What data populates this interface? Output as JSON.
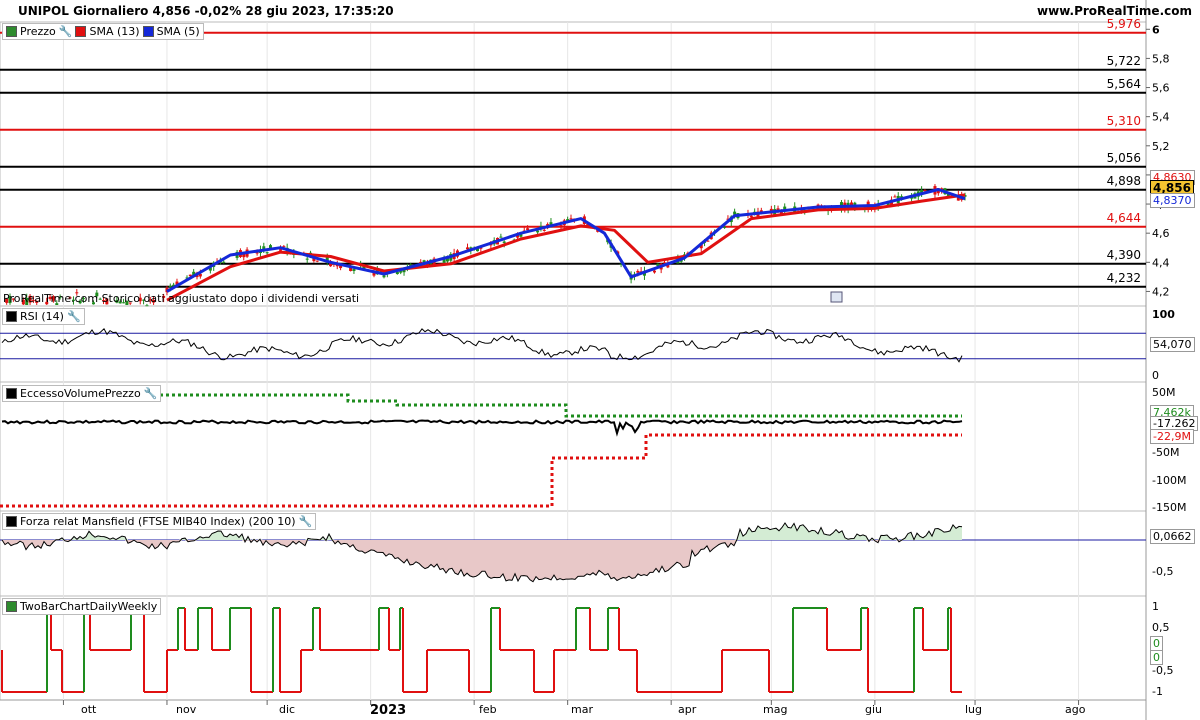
{
  "header": {
    "title": "UNIPOL Giornaliero 4,856 -0,02% 28 giu 2023, 17:35:20",
    "site": "www.ProRealTime.com"
  },
  "legend_main": [
    {
      "label": "Prezzo",
      "color": "#2e8b2e"
    },
    {
      "label": "SMA (13)",
      "color": "#e01010"
    },
    {
      "label": "SMA (5)",
      "color": "#1428d8"
    }
  ],
  "note": "ProRealTime.com Storico dati aggiustato dopo i dividendi versati",
  "price_levels": [
    {
      "label": "5,976",
      "value": 5.976,
      "color": "#e01010"
    },
    {
      "label": "5,722",
      "value": 5.722,
      "color": "#000000"
    },
    {
      "label": "5,564",
      "value": 5.564,
      "color": "#000000"
    },
    {
      "label": "5,310",
      "value": 5.31,
      "color": "#e01010"
    },
    {
      "label": "5,056",
      "value": 5.056,
      "color": "#000000"
    },
    {
      "label": "4,898",
      "value": 4.898,
      "color": "#000000"
    },
    {
      "label": "4,644",
      "value": 4.644,
      "color": "#e01010"
    },
    {
      "label": "4,390",
      "value": 4.39,
      "color": "#000000"
    },
    {
      "label": "4,232",
      "value": 4.232,
      "color": "#000000"
    }
  ],
  "price_axis": [
    "6",
    "5,8",
    "5,6",
    "5,4",
    "5,2",
    "5",
    "4,8",
    "4,6",
    "4,4",
    "4,2"
  ],
  "price_badges": {
    "sma13": "4,8630",
    "last": "4,856",
    "sma5": "4,8370"
  },
  "rsi": {
    "legend": "RSI (14)",
    "axis_top": "100",
    "axis_bottom": "0",
    "value": "54,070",
    "upper": 70,
    "lower": 30
  },
  "volume": {
    "legend": "EccessoVolumePrezzo",
    "axis": [
      "50M",
      "-50M",
      "-100M",
      "-150M"
    ],
    "green_value": "7,462k",
    "black_value": "-17.262",
    "red_value": "-22,9M"
  },
  "mansfield": {
    "legend": "Forza relat Mansfield (FTSE MIB40 Index) (200 10)",
    "value": "0,0662",
    "axis": [
      "-0,5"
    ]
  },
  "twobar": {
    "legend": "TwoBarChartDailyWeekly",
    "axis": [
      "1",
      "0,5",
      "0",
      "-0,5",
      "-1"
    ],
    "badge1": "0",
    "badge2": "0"
  },
  "months": [
    "ott",
    "nov",
    "dic",
    "2023",
    "feb",
    "mar",
    "apr",
    "mag",
    "giu",
    "lug",
    "ago"
  ],
  "colors": {
    "up": "#1e8c1e",
    "down": "#e01010",
    "sma13": "#e01010",
    "sma5": "#1428d8",
    "ref": "#1a1aa0",
    "fill_neg": "#e8c8c8",
    "fill_pos": "#d4ecd4"
  },
  "chart_data": {
    "type": "candlestick",
    "symbol": "UNIPOL",
    "timeframe": "Giornaliero",
    "last": 4.856,
    "change_pct": -0.02,
    "ylim": [
      4.1,
      6.05
    ],
    "x_range": [
      "2022-09-12",
      "2023-08-20"
    ],
    "sma13_series": [
      {
        "date": "2022-11-01",
        "value": 4.14
      },
      {
        "date": "2022-11-20",
        "value": 4.37
      },
      {
        "date": "2022-12-05",
        "value": 4.47
      },
      {
        "date": "2022-12-20",
        "value": 4.44
      },
      {
        "date": "2023-01-05",
        "value": 4.34
      },
      {
        "date": "2023-01-25",
        "value": 4.39
      },
      {
        "date": "2023-02-15",
        "value": 4.56
      },
      {
        "date": "2023-03-05",
        "value": 4.65
      },
      {
        "date": "2023-03-15",
        "value": 4.62
      },
      {
        "date": "2023-03-25",
        "value": 4.4
      },
      {
        "date": "2023-04-10",
        "value": 4.46
      },
      {
        "date": "2023-04-25",
        "value": 4.7
      },
      {
        "date": "2023-05-15",
        "value": 4.76
      },
      {
        "date": "2023-06-01",
        "value": 4.77
      },
      {
        "date": "2023-06-15",
        "value": 4.82
      },
      {
        "date": "2023-06-28",
        "value": 4.863
      }
    ],
    "sma5_series": [
      {
        "date": "2022-11-01",
        "value": 4.2
      },
      {
        "date": "2022-11-20",
        "value": 4.45
      },
      {
        "date": "2022-12-05",
        "value": 4.5
      },
      {
        "date": "2022-12-20",
        "value": 4.4
      },
      {
        "date": "2023-01-05",
        "value": 4.32
      },
      {
        "date": "2023-01-25",
        "value": 4.44
      },
      {
        "date": "2023-02-15",
        "value": 4.6
      },
      {
        "date": "2023-03-05",
        "value": 4.7
      },
      {
        "date": "2023-03-12",
        "value": 4.6
      },
      {
        "date": "2023-03-20",
        "value": 4.3
      },
      {
        "date": "2023-04-05",
        "value": 4.43
      },
      {
        "date": "2023-04-20",
        "value": 4.72
      },
      {
        "date": "2023-05-15",
        "value": 4.78
      },
      {
        "date": "2023-06-01",
        "value": 4.79
      },
      {
        "date": "2023-06-20",
        "value": 4.9
      },
      {
        "date": "2023-06-28",
        "value": 4.837
      }
    ]
  }
}
